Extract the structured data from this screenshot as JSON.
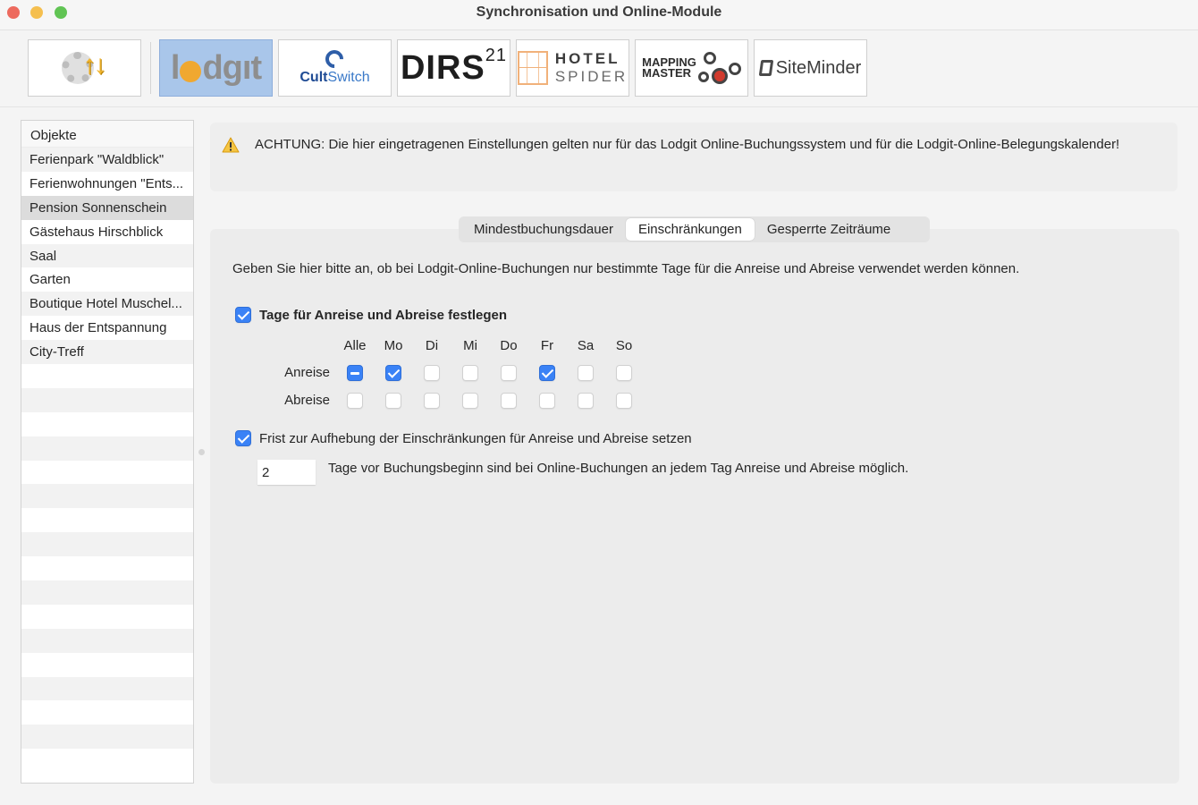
{
  "window": {
    "title": "Synchronisation und Online-Module"
  },
  "toolbar": {
    "buttons": [
      {
        "name": "sync-settings",
        "label": "Synchronisation",
        "icon": "gear-sync-arrows-icon",
        "active": false
      },
      {
        "name": "lodgit",
        "label": "lodgit",
        "active": true
      },
      {
        "name": "cultswitch",
        "label_a": "Cult",
        "label_b": "Switch",
        "active": false
      },
      {
        "name": "dirs21",
        "label": "DIRS",
        "sup": "21",
        "active": false
      },
      {
        "name": "hotel-spider",
        "label_a": "HOTEL",
        "label_b": "SPIDER",
        "active": false
      },
      {
        "name": "mapping-master",
        "label_a": "MAPPING",
        "label_b": "MASTER",
        "active": false
      },
      {
        "name": "siteminder",
        "label": "SiteMinder",
        "active": false
      }
    ]
  },
  "sidebar": {
    "header": "Objekte",
    "items": [
      {
        "label": "Ferienpark \"Waldblick\"",
        "selected": false
      },
      {
        "label": "Ferienwohnungen \"Ents...",
        "selected": false
      },
      {
        "label": "Pension Sonnenschein",
        "selected": true
      },
      {
        "label": "Gästehaus Hirschblick",
        "selected": false
      },
      {
        "label": "Saal",
        "selected": false
      },
      {
        "label": "Garten",
        "selected": false
      },
      {
        "label": "Boutique Hotel Muschel...",
        "selected": false
      },
      {
        "label": "Haus der Entspannung",
        "selected": false
      },
      {
        "label": "City-Treff",
        "selected": false
      }
    ],
    "empty_rows": 17
  },
  "warning": {
    "icon": "warning-triangle-icon",
    "text": "ACHTUNG: Die hier eingetragenen Einstellungen gelten nur für das Lodgit Online-Buchungssystem und für die Lodgit-Online-Belegungskalender!"
  },
  "tabs": [
    {
      "label": "Mindestbuchungsdauer",
      "active": false
    },
    {
      "label": "Einschränkungen",
      "active": true
    },
    {
      "label": "Gesperrte Zeiträume",
      "active": false
    }
  ],
  "restrictions": {
    "intro": "Geben Sie hier bitte an, ob bei Lodgit-Online-Buchungen nur bestimmte Tage für die Anreise und Abreise verwendet werden können.",
    "set_days": {
      "label": "Tage für Anreise und Abreise festlegen",
      "checked": true
    },
    "columns": [
      "Alle",
      "Mo",
      "Di",
      "Mi",
      "Do",
      "Fr",
      "Sa",
      "So"
    ],
    "rows": [
      {
        "label": "Anreise",
        "states": [
          "mixed",
          "checked",
          "unchecked",
          "unchecked",
          "unchecked",
          "checked",
          "unchecked",
          "unchecked"
        ]
      },
      {
        "label": "Abreise",
        "states": [
          "unchecked",
          "unchecked",
          "unchecked",
          "unchecked",
          "unchecked",
          "unchecked",
          "unchecked",
          "unchecked"
        ]
      }
    ],
    "deadline": {
      "label": "Frist zur Aufhebung der Einschränkungen für Anreise und Abreise setzen",
      "checked": true
    },
    "days_value": "2",
    "days_description": "Tage vor Buchungsbeginn sind bei Online-Buchungen an jedem Tag Anreise und Abreise möglich."
  }
}
